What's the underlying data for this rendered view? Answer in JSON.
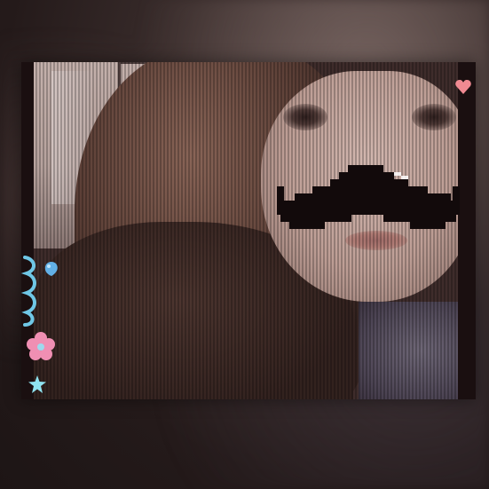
{
  "photo": {
    "subject": "selfie",
    "filter": "vertical-scanlines"
  },
  "stickers": {
    "mustache": "pixel-mustache-icon",
    "heart": "heart-icon",
    "balloon": "balloon-icon",
    "flower": "flower-icon",
    "star": "star-icon",
    "ribbon": "ribbon-icon"
  },
  "colors": {
    "mustache": "#120a0b",
    "heart": "#f08a92",
    "flower": "#f08fb3",
    "ribbon": "#6fc7e6",
    "star": "#8fe3f0",
    "balloon": "#62b0e6",
    "frame_bar": "#1a0f10"
  }
}
